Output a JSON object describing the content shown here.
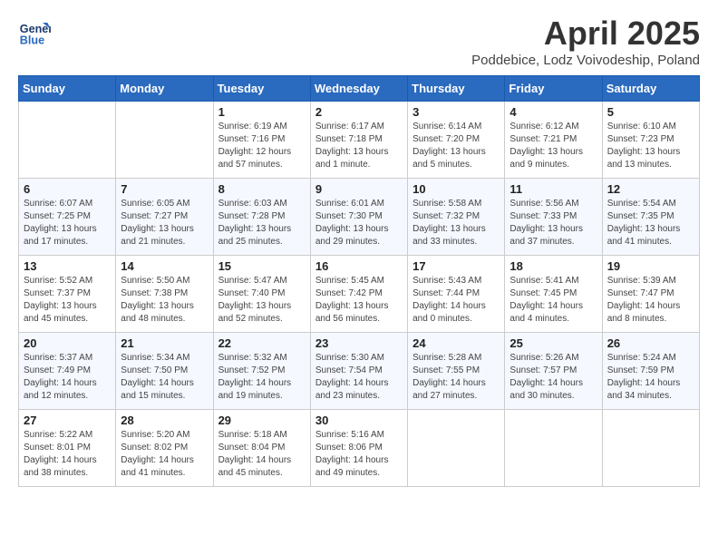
{
  "header": {
    "logo_line1": "General",
    "logo_line2": "Blue",
    "month_year": "April 2025",
    "location": "Poddebice, Lodz Voivodeship, Poland"
  },
  "days_of_week": [
    "Sunday",
    "Monday",
    "Tuesday",
    "Wednesday",
    "Thursday",
    "Friday",
    "Saturday"
  ],
  "weeks": [
    [
      {
        "num": "",
        "info": ""
      },
      {
        "num": "",
        "info": ""
      },
      {
        "num": "1",
        "info": "Sunrise: 6:19 AM\nSunset: 7:16 PM\nDaylight: 12 hours\nand 57 minutes."
      },
      {
        "num": "2",
        "info": "Sunrise: 6:17 AM\nSunset: 7:18 PM\nDaylight: 13 hours\nand 1 minute."
      },
      {
        "num": "3",
        "info": "Sunrise: 6:14 AM\nSunset: 7:20 PM\nDaylight: 13 hours\nand 5 minutes."
      },
      {
        "num": "4",
        "info": "Sunrise: 6:12 AM\nSunset: 7:21 PM\nDaylight: 13 hours\nand 9 minutes."
      },
      {
        "num": "5",
        "info": "Sunrise: 6:10 AM\nSunset: 7:23 PM\nDaylight: 13 hours\nand 13 minutes."
      }
    ],
    [
      {
        "num": "6",
        "info": "Sunrise: 6:07 AM\nSunset: 7:25 PM\nDaylight: 13 hours\nand 17 minutes."
      },
      {
        "num": "7",
        "info": "Sunrise: 6:05 AM\nSunset: 7:27 PM\nDaylight: 13 hours\nand 21 minutes."
      },
      {
        "num": "8",
        "info": "Sunrise: 6:03 AM\nSunset: 7:28 PM\nDaylight: 13 hours\nand 25 minutes."
      },
      {
        "num": "9",
        "info": "Sunrise: 6:01 AM\nSunset: 7:30 PM\nDaylight: 13 hours\nand 29 minutes."
      },
      {
        "num": "10",
        "info": "Sunrise: 5:58 AM\nSunset: 7:32 PM\nDaylight: 13 hours\nand 33 minutes."
      },
      {
        "num": "11",
        "info": "Sunrise: 5:56 AM\nSunset: 7:33 PM\nDaylight: 13 hours\nand 37 minutes."
      },
      {
        "num": "12",
        "info": "Sunrise: 5:54 AM\nSunset: 7:35 PM\nDaylight: 13 hours\nand 41 minutes."
      }
    ],
    [
      {
        "num": "13",
        "info": "Sunrise: 5:52 AM\nSunset: 7:37 PM\nDaylight: 13 hours\nand 45 minutes."
      },
      {
        "num": "14",
        "info": "Sunrise: 5:50 AM\nSunset: 7:38 PM\nDaylight: 13 hours\nand 48 minutes."
      },
      {
        "num": "15",
        "info": "Sunrise: 5:47 AM\nSunset: 7:40 PM\nDaylight: 13 hours\nand 52 minutes."
      },
      {
        "num": "16",
        "info": "Sunrise: 5:45 AM\nSunset: 7:42 PM\nDaylight: 13 hours\nand 56 minutes."
      },
      {
        "num": "17",
        "info": "Sunrise: 5:43 AM\nSunset: 7:44 PM\nDaylight: 14 hours\nand 0 minutes."
      },
      {
        "num": "18",
        "info": "Sunrise: 5:41 AM\nSunset: 7:45 PM\nDaylight: 14 hours\nand 4 minutes."
      },
      {
        "num": "19",
        "info": "Sunrise: 5:39 AM\nSunset: 7:47 PM\nDaylight: 14 hours\nand 8 minutes."
      }
    ],
    [
      {
        "num": "20",
        "info": "Sunrise: 5:37 AM\nSunset: 7:49 PM\nDaylight: 14 hours\nand 12 minutes."
      },
      {
        "num": "21",
        "info": "Sunrise: 5:34 AM\nSunset: 7:50 PM\nDaylight: 14 hours\nand 15 minutes."
      },
      {
        "num": "22",
        "info": "Sunrise: 5:32 AM\nSunset: 7:52 PM\nDaylight: 14 hours\nand 19 minutes."
      },
      {
        "num": "23",
        "info": "Sunrise: 5:30 AM\nSunset: 7:54 PM\nDaylight: 14 hours\nand 23 minutes."
      },
      {
        "num": "24",
        "info": "Sunrise: 5:28 AM\nSunset: 7:55 PM\nDaylight: 14 hours\nand 27 minutes."
      },
      {
        "num": "25",
        "info": "Sunrise: 5:26 AM\nSunset: 7:57 PM\nDaylight: 14 hours\nand 30 minutes."
      },
      {
        "num": "26",
        "info": "Sunrise: 5:24 AM\nSunset: 7:59 PM\nDaylight: 14 hours\nand 34 minutes."
      }
    ],
    [
      {
        "num": "27",
        "info": "Sunrise: 5:22 AM\nSunset: 8:01 PM\nDaylight: 14 hours\nand 38 minutes."
      },
      {
        "num": "28",
        "info": "Sunrise: 5:20 AM\nSunset: 8:02 PM\nDaylight: 14 hours\nand 41 minutes."
      },
      {
        "num": "29",
        "info": "Sunrise: 5:18 AM\nSunset: 8:04 PM\nDaylight: 14 hours\nand 45 minutes."
      },
      {
        "num": "30",
        "info": "Sunrise: 5:16 AM\nSunset: 8:06 PM\nDaylight: 14 hours\nand 49 minutes."
      },
      {
        "num": "",
        "info": ""
      },
      {
        "num": "",
        "info": ""
      },
      {
        "num": "",
        "info": ""
      }
    ]
  ]
}
